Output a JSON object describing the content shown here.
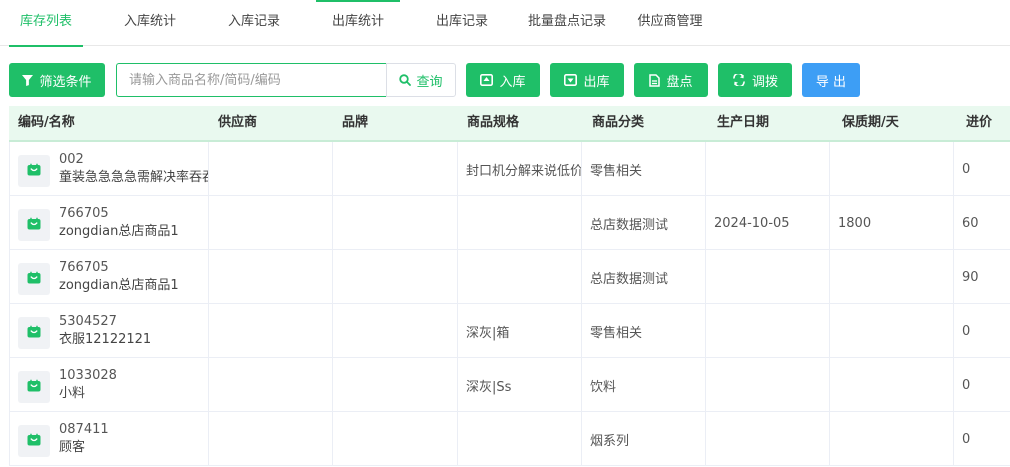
{
  "tabs": [
    {
      "label": "库存列表"
    },
    {
      "label": "入库统计"
    },
    {
      "label": "入库记录"
    },
    {
      "label": "出库统计"
    },
    {
      "label": "出库记录"
    },
    {
      "label": "批量盘点记录"
    },
    {
      "label": "供应商管理"
    }
  ],
  "toolbar": {
    "filter_label": "筛选条件",
    "search_placeholder": "请输入商品名称/简码/编码",
    "search_label": "查询",
    "stock_in_label": "入库",
    "stock_out_label": "出库",
    "inventory_label": "盘点",
    "transfer_label": "调拨",
    "export_label": "导 出"
  },
  "colors": {
    "accent": "#1fbf68",
    "blue": "#3d9ef5"
  },
  "table": {
    "headers": [
      "编码/名称",
      "供应商",
      "品牌",
      "商品规格",
      "商品分类",
      "生产日期",
      "保质期/天",
      "进价"
    ],
    "rows": [
      {
        "code": "002",
        "name": "童装急急急急需解决率吞吞",
        "supplier": "",
        "brand": "",
        "spec": "封口机分解来说低价",
        "category": "零售相关",
        "date": "",
        "shelf": "",
        "price": "0"
      },
      {
        "code": "766705",
        "name": "zongdian总店商品1",
        "supplier": "",
        "brand": "",
        "spec": "",
        "category": "总店数据测试",
        "date": "2024-10-05",
        "shelf": "1800",
        "price": "60"
      },
      {
        "code": "766705",
        "name": "zongdian总店商品1",
        "supplier": "",
        "brand": "",
        "spec": "",
        "category": "总店数据测试",
        "date": "",
        "shelf": "",
        "price": "90"
      },
      {
        "code": "5304527",
        "name": "衣服12122121",
        "supplier": "",
        "brand": "",
        "spec": "深灰|箱",
        "category": "零售相关",
        "date": "",
        "shelf": "",
        "price": "0"
      },
      {
        "code": "1033028",
        "name": "小料",
        "supplier": "",
        "brand": "",
        "spec": "深灰|Ss",
        "category": "饮料",
        "date": "",
        "shelf": "",
        "price": "0"
      },
      {
        "code": "087411",
        "name": "顾客",
        "supplier": "",
        "brand": "",
        "spec": "",
        "category": "烟系列",
        "date": "",
        "shelf": "",
        "price": "0"
      }
    ]
  }
}
